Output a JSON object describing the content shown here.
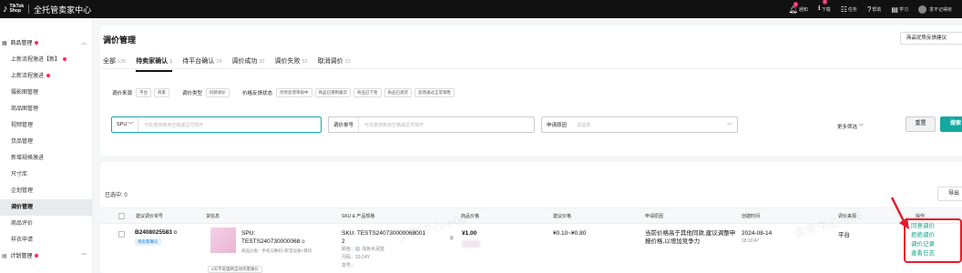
{
  "topbar": {
    "logo_line1": "TikTok",
    "logo_line2": "Shop",
    "title": "全托管卖家中心",
    "items": [
      {
        "icon": "bell-icon",
        "label": "通知",
        "badge": "9"
      },
      {
        "icon": "download-icon",
        "label": "下载",
        "badge": "2"
      },
      {
        "icon": "tasks-icon",
        "label": "任务"
      },
      {
        "icon": "help-icon",
        "label": "帮助"
      },
      {
        "icon": "learn-icon",
        "label": "学习"
      }
    ],
    "user": "发不记得房"
  },
  "sidebar": {
    "group1": "商品管理",
    "items": [
      {
        "label": "上新流程激进【新】",
        "dot": true
      },
      {
        "label": "上新流程激进",
        "dot": true
      },
      {
        "label": "摄影图管理"
      },
      {
        "label": "商品图管理"
      },
      {
        "label": "视频管理"
      },
      {
        "label": "货品管理"
      },
      {
        "label": "新增规格激进"
      },
      {
        "label": "尺寸库"
      },
      {
        "label": "企划管理"
      },
      {
        "label": "调价管理",
        "active": true
      },
      {
        "label": "商品评价"
      },
      {
        "label": "样衣申请"
      }
    ],
    "group2": "计划管理"
  },
  "main": {
    "title": "调价管理",
    "top_button": "商品优势反馈建议",
    "tabs": [
      {
        "label": "全部",
        "count": "135"
      },
      {
        "label": "待卖家确认",
        "count": "1",
        "active": true
      },
      {
        "label": "待平台确认",
        "count": "24"
      },
      {
        "label": "调价成功",
        "count": "30"
      },
      {
        "label": "调价失败",
        "count": "52"
      },
      {
        "label": "取消调价",
        "count": "23"
      }
    ],
    "filters": {
      "source_label": "调价来源",
      "source_options": [
        "平台",
        "商家"
      ],
      "type_label": "调价类型",
      "type_options": [
        "同款调价"
      ],
      "feedback_label": "价格反馈状态",
      "feedback_options": [
        "优势反馈审核中",
        "商品已限制备货",
        "商品已下架",
        "商品已退货",
        "反馈通过正常销售"
      ]
    },
    "search": {
      "spu_label": "SPU",
      "spu_placeholder": "可批量搜索用空格或逗号隔开",
      "order_label": "调价单号",
      "order_placeholder": "可批量搜索用空格或逗号隔开",
      "reason_label": "申请原因",
      "reason_placeholder": "请选择",
      "more": "更多筛选",
      "reset": "重置",
      "search": "搜索"
    },
    "table": {
      "selected": "已选中: 0",
      "export": "导出",
      "headers": [
        "建议调价单号",
        "货信息",
        "SKU & 产品规格",
        "商品价格",
        "建议价格",
        "申请原因",
        "创建时间",
        "调价来源",
        "操作"
      ],
      "row": {
        "order_no": "B2408025583",
        "status_tag": "待卖家确认",
        "spu_line1": "SPU:",
        "spu_line2": "TESTS240730000068",
        "category": "商品分类：手机与数码>影音设备>耳机",
        "pill": "2天不处理将自动作废报价",
        "sku_line1": "SKU: TESTS240730000068001",
        "sku_line2": "2",
        "color": "颜色：",
        "color_val": "浅色水泥蓝",
        "size": "尺码：13-14Y",
        "goods_no": "货号：",
        "price": "¥1.00",
        "suggest": "¥0.10~¥0.80",
        "reason": "当前价格高于其他同款,建议调整申报价格,以增加竞争力",
        "date": "2024-08-14",
        "time": "18:10:47",
        "source": "平台",
        "actions": [
          "同意调价",
          "拒绝调价",
          "调价记录",
          "查看日志"
        ]
      }
    },
    "watermark": "卖家中心-e06"
  }
}
